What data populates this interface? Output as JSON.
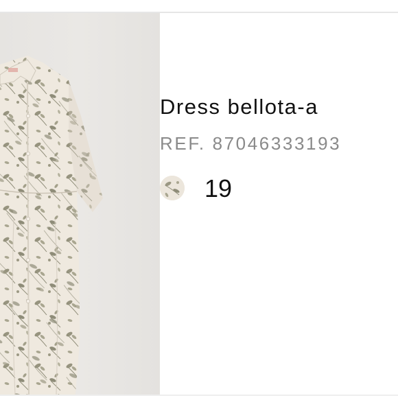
{
  "product": {
    "name": "Dress bellota-a",
    "reference": "REF. 87046333193",
    "color_count": "19",
    "image_alt": "Floral print shirt dress",
    "swatch_icon": "color-swatch-icon"
  },
  "colors": {
    "background": "#ffffff",
    "photo_background": "#e8e6e3",
    "dress_base": "#efe9df",
    "print_color": "#8e8c78",
    "name_text": "#111111",
    "reference_text": "#8a8a8a",
    "divider": "#e6e6e6"
  }
}
